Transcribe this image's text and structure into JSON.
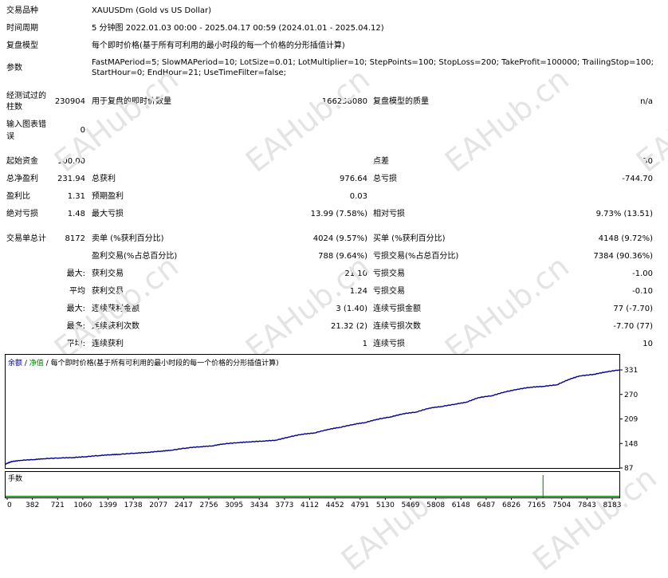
{
  "report": {
    "symbol_label": "交易品种",
    "symbol_value": "XAUUSDm (Gold vs US Dollar)",
    "period_label": "时间周期",
    "period_value": "5 分钟图 2022.01.03 00:00 - 2025.04.17 00:59 (2024.01.01 - 2025.04.12)",
    "model_label": "复盘模型",
    "model_value": "每个即时价格(基于所有可利用的最小时段的每一个价格的分形插值计算)",
    "params_label": "参数",
    "params_line1": "FastMAPeriod=5; SlowMAPeriod=10; LotSize=0.01; LotMultiplier=10; StepPoints=100; StopLoss=200; TakeProfit=100000; TrailingStop=100;",
    "params_line2": "StartHour=0; EndHour=21; UseTimeFilter=false;",
    "bars_label_1": "经测试过的",
    "bars_label_2": "柱数",
    "bars_value": "230904",
    "ticks_label": "用于复盘的即时价数量",
    "ticks_value": "166258080",
    "quality_label": "复盘模型的质量",
    "quality_value": "n/a",
    "errors_label_1": "输入图表错",
    "errors_label_2": "误",
    "errors_value": "0",
    "deposit_label": "起始资金",
    "deposit_value": "100.00",
    "spread_label": "点差",
    "spread_value": "30",
    "net_label": "总净盈利",
    "net_value": "231.94",
    "gross_profit_label": "总获利",
    "gross_profit_value": "976.64",
    "gross_loss_label": "总亏损",
    "gross_loss_value": "-744.70",
    "pf_label": "盈利比",
    "pf_value": "1.31",
    "ep_label": "预期盈利",
    "ep_value": "0.03",
    "abs_dd_label": "绝对亏损",
    "abs_dd_value": "1.48",
    "max_dd_label": "最大亏损",
    "max_dd_value": "13.99 (7.58%)",
    "rel_dd_label": "相对亏损",
    "rel_dd_value": "9.73% (13.51)",
    "trades_label": "交易单总计",
    "trades_value": "8172",
    "short_label": "卖单 (%获利百分比)",
    "short_value": "4024 (9.57%)",
    "long_label": "买单 (%获利百分比)",
    "long_value": "4148 (9.72%)",
    "win_label": "盈利交易(%占总百分比)",
    "win_value": "788 (9.64%)",
    "loss_label": "亏损交易(%占总百分比)",
    "loss_value": "7384 (90.36%)",
    "r1_prefix": "最大:",
    "r1_a_label": "获利交易",
    "r1_a_value": "21.10",
    "r1_b_label": "亏损交易",
    "r1_b_value": "-1.00",
    "r2_prefix": "平均",
    "r2_a_label": "获利交易",
    "r2_a_value": "1.24",
    "r2_b_label": "亏损交易",
    "r2_b_value": "-0.10",
    "r3_prefix": "最大:",
    "r3_a_label": "连续获利金额",
    "r3_a_value": "3 (1.40)",
    "r3_b_label": "连续亏损金额",
    "r3_b_value": "77 (-7.70)",
    "r4_prefix": "最多:",
    "r4_a_label": "连续获利次数",
    "r4_a_value": "21.32 (2)",
    "r4_b_label": "连续亏损次数",
    "r4_b_value": "-7.70 (77)",
    "r5_prefix": "平均:",
    "r5_a_label": "连续获利",
    "r5_a_value": "1",
    "r5_b_label": "连续亏损",
    "r5_b_value": "10"
  },
  "watermark": "EAHub.cn",
  "chart_data": {
    "type": "line",
    "title_balance": "余额",
    "title_sep1": " / ",
    "title_equity": "净值",
    "title_sep2": " / ",
    "title_model": "每个即时价格(基于所有可利用的最小时段的每一个价格的分形插值计算)",
    "lots_label": "手数",
    "ylim": [
      87,
      331
    ],
    "y_ticks": [
      "331",
      "270",
      "209",
      "148",
      "87"
    ],
    "xlim": [
      0,
      8183
    ],
    "x_ticks": [
      "0",
      "382",
      "721",
      "1060",
      "1399",
      "1738",
      "2077",
      "2417",
      "2756",
      "3095",
      "3434",
      "3773",
      "4112",
      "4452",
      "4791",
      "5130",
      "5469",
      "5808",
      "6148",
      "6487",
      "6826",
      "7165",
      "7504",
      "7843",
      "8183"
    ],
    "series": [
      {
        "color": "#00008b",
        "x": [
          0,
          80,
          200,
          382,
          500,
          721,
          900,
          1060,
          1250,
          1399,
          1500,
          1738,
          1900,
          2077,
          2200,
          2417,
          2600,
          2756,
          2900,
          3095,
          3250,
          3434,
          3600,
          3773,
          3950,
          4112,
          4300,
          4452,
          4650,
          4791,
          4950,
          5130,
          5300,
          5469,
          5650,
          5808,
          6000,
          6148,
          6300,
          6487,
          6650,
          6826,
          7000,
          7165,
          7350,
          7504,
          7650,
          7843,
          8000,
          8183
        ],
        "y": [
          97,
          103,
          106,
          108,
          110,
          112,
          113,
          115,
          118,
          120,
          121,
          124,
          126,
          129,
          131,
          137,
          140,
          142,
          147,
          150,
          152,
          154,
          156,
          164,
          171,
          174,
          183,
          188,
          196,
          200,
          208,
          214,
          222,
          226,
          236,
          240,
          246,
          251,
          262,
          267,
          276,
          283,
          288,
          290,
          294,
          307,
          316,
          320,
          326,
          331
        ]
      }
    ],
    "lots_spike_x": 7165,
    "lots_spike_value": 1,
    "lots_base_value": 0.05,
    "colors": {
      "balance": "#00008b",
      "lots": "#008000",
      "frame": "#000000"
    }
  }
}
